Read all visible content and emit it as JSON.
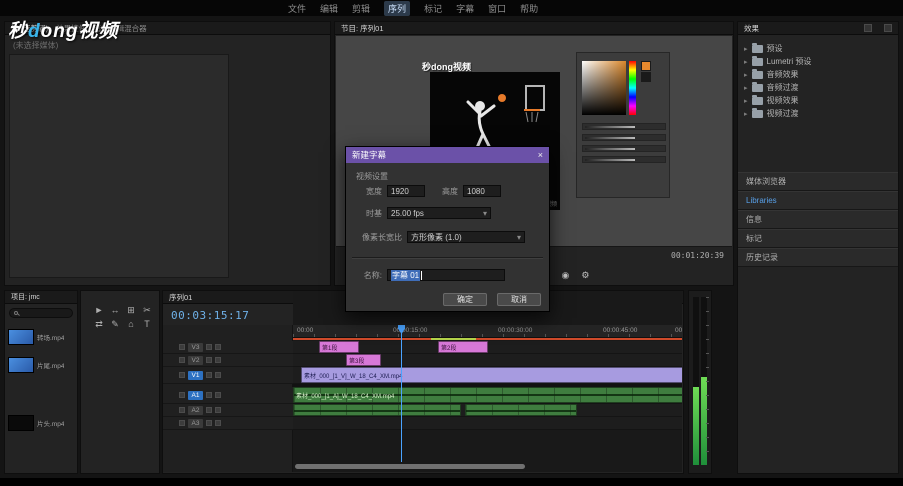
{
  "menubar": {
    "items": [
      "文件",
      "编辑",
      "剪辑",
      "序列",
      "标记",
      "字幕",
      "窗口",
      "帮助"
    ]
  },
  "logo": {
    "prefix": "秒",
    "accent": "d",
    "middle": "ong",
    "suffix": "视频"
  },
  "icons": {
    "chevron_down": "▾",
    "tree_arrow": "▸"
  },
  "source_panel": {
    "tabs": [
      "源:(无剪辑)",
      "效果控件",
      "音频剪辑混合器"
    ],
    "empty_text": "(未选择媒体)"
  },
  "program_panel": {
    "tab": "节目: 序列01",
    "watermark": "秒dong视频",
    "video_watermark": "秒dong视频",
    "duration": "00:01:20:39",
    "transport": [
      {
        "name": "go-to-in",
        "glyph": "«"
      },
      {
        "name": "step-back",
        "glyph": "‹"
      },
      {
        "name": "play",
        "glyph": "▶"
      },
      {
        "name": "step-forward",
        "glyph": "›"
      },
      {
        "name": "go-to-out",
        "glyph": "»"
      },
      {
        "name": "export-frame",
        "glyph": "◉"
      },
      {
        "name": "settings",
        "glyph": "⚙"
      }
    ]
  },
  "dialog": {
    "title": "新建字幕",
    "close": "×",
    "section": "视频设置",
    "width_label": "宽度",
    "width_value": "1920",
    "height_label": "高度",
    "height_value": "1080",
    "timebase_label": "时基",
    "timebase_value": "25.00 fps",
    "par_label": "像素长宽比",
    "par_value": "方形像素 (1.0)",
    "name_label": "名称:",
    "name_value": "字幕 01",
    "ok_label": "确定",
    "cancel_label": "取消"
  },
  "effects_panel": {
    "tab": "效果",
    "items": [
      "预设",
      "Lumetri 预设",
      "音频效果",
      "音频过渡",
      "视频效果",
      "视频过渡"
    ]
  },
  "right_stack": {
    "rows": [
      "媒体浏览器",
      "Libraries",
      "信息",
      "标记",
      "历史记录"
    ]
  },
  "project_panel": {
    "tab": "项目: jmc",
    "items": [
      {
        "name": "转场.mp4"
      },
      {
        "name": "片尾.mp4"
      },
      {
        "name": "片头.mp4"
      }
    ]
  },
  "tools": {
    "items": [
      {
        "name": "selection-tool",
        "glyph": "►"
      },
      {
        "name": "track-select-tool",
        "glyph": "↔"
      },
      {
        "name": "ripple-edit-tool",
        "glyph": "⊞"
      },
      {
        "name": "razor-tool",
        "glyph": "✂"
      },
      {
        "name": "slip-tool",
        "glyph": "⇄"
      },
      {
        "name": "pen-tool",
        "glyph": "✎"
      },
      {
        "name": "hand-tool",
        "glyph": "⌂"
      },
      {
        "name": "type-tool",
        "glyph": "T"
      }
    ]
  },
  "timeline": {
    "tab": "序列01",
    "timecode": "00:03:15:17",
    "ruler_labels": [
      "00:00",
      "00:00:15:00",
      "00:00:30:00",
      "00:00:45:00",
      "00"
    ],
    "video_tracks": [
      "V3",
      "V2",
      "V1"
    ],
    "audio_tracks": [
      "A1",
      "A2",
      "A3"
    ],
    "clips": {
      "v3": [
        {
          "label": "第1段"
        },
        {
          "label": "第2段"
        }
      ],
      "v2": [
        {
          "label": "第3段"
        }
      ],
      "v1": [
        {
          "label": "素材_000_[1_V]_W_18_C4_XM.mp4"
        }
      ],
      "a1": [
        {
          "label": "素材_000_[1_A]_W_18_C4_XM.mp4"
        }
      ]
    }
  },
  "colors": {
    "dialog_purple": "#6b51a8",
    "clip_magenta": "#d778d7",
    "clip_lavender": "#a79be0",
    "clip_green": "#3f7d3f",
    "timecode_blue": "#6fb1e8",
    "meter_green": "#43b34a"
  }
}
